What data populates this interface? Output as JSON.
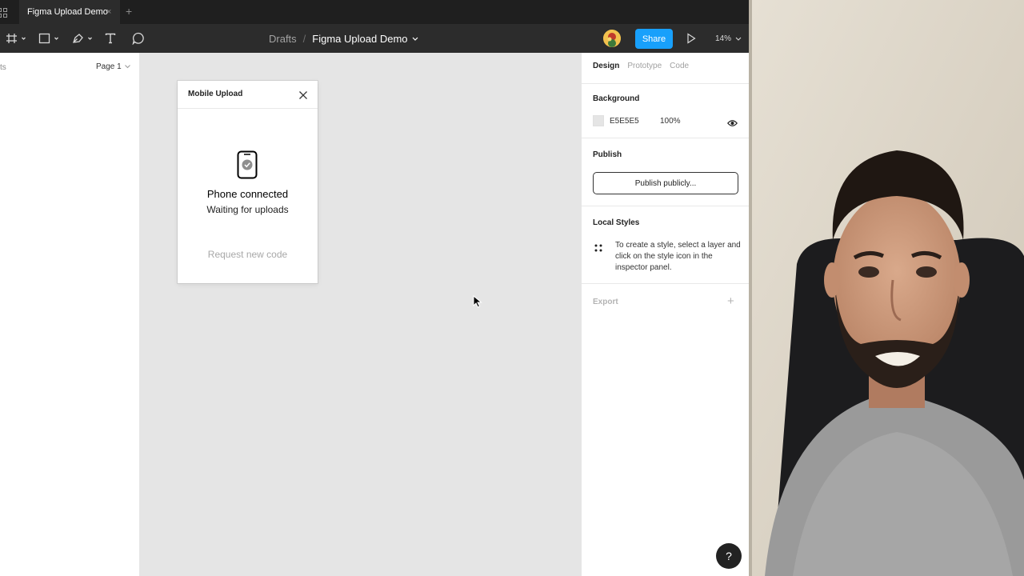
{
  "tabbar": {
    "tab_title": "Figma Upload Demo",
    "tab_close": "×",
    "add_tab": "+"
  },
  "toolbar": {
    "tools": [
      "frame-icon",
      "rectangle-icon",
      "pen-icon",
      "text-icon",
      "comment-icon"
    ],
    "breadcrumb": {
      "drafts": "Drafts",
      "separator": "/",
      "file": "Figma Upload Demo"
    },
    "share_label": "Share",
    "zoom": "14%"
  },
  "left_panel": {
    "clipped_label": "ts",
    "page_selector": "Page 1"
  },
  "canvas": {
    "background": "#E5E5E5",
    "frame": {
      "title": "Mobile Upload",
      "status_title": "Phone connected",
      "status_subtitle": "Waiting for uploads",
      "request_link": "Request new code"
    }
  },
  "right_panel": {
    "tabs": [
      {
        "label": "Design",
        "active": true
      },
      {
        "label": "Prototype",
        "active": false
      },
      {
        "label": "Code",
        "active": false
      }
    ],
    "background": {
      "heading": "Background",
      "hex": "E5E5E5",
      "opacity": "100%"
    },
    "publish": {
      "heading": "Publish",
      "button": "Publish publicly..."
    },
    "local_styles": {
      "heading": "Local Styles",
      "description": "To create a style, select a layer and click on the style icon in the inspector panel."
    },
    "export": {
      "heading": "Export",
      "add": "+"
    },
    "help": "?"
  },
  "colors": {
    "accent": "#18A0FB",
    "toolbar": "#2C2C2C",
    "tabbar": "#1F1F1F",
    "canvas": "#E5E5E5"
  }
}
